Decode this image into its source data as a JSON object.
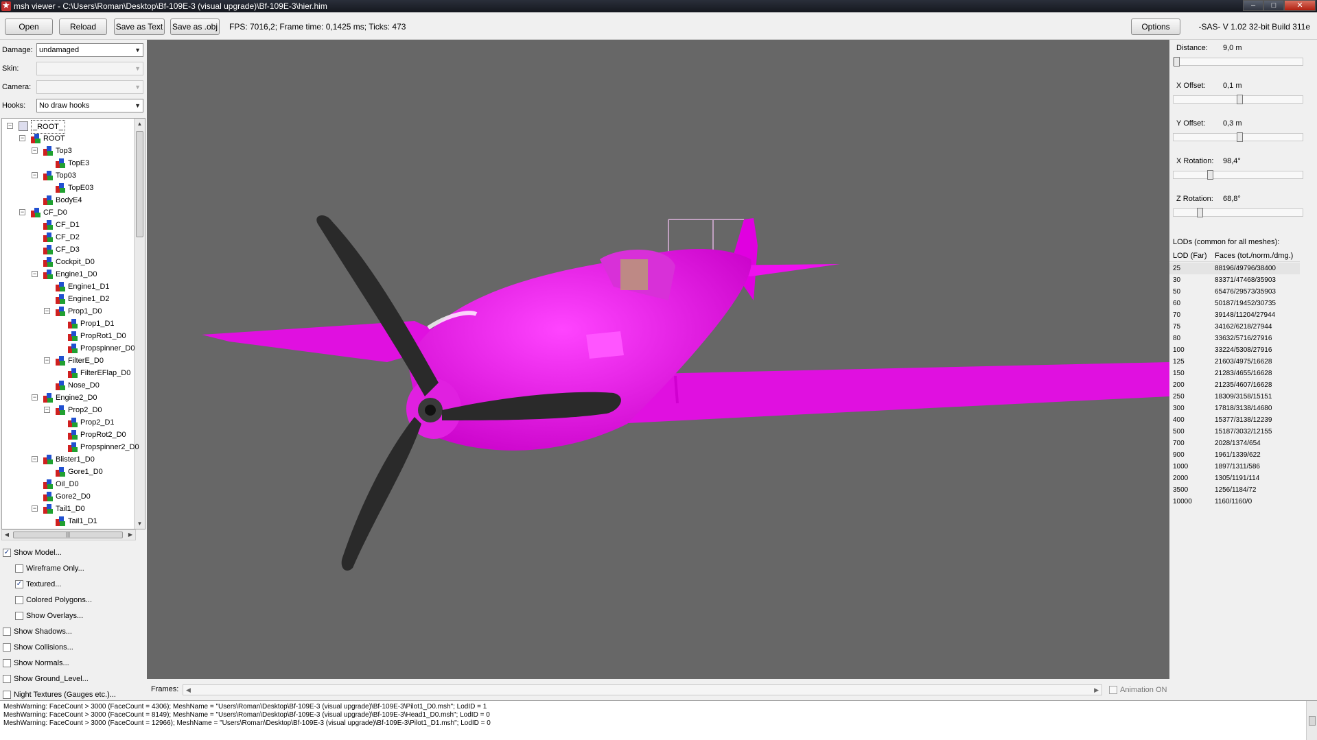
{
  "window": {
    "title": "msh viewer - C:\\Users\\Roman\\Desktop\\Bf-109E-3 (visual upgrade)\\Bf-109E-3\\hier.him"
  },
  "toolbar": {
    "open": "Open",
    "reload": "Reload",
    "save_text": "Save as Text",
    "save_obj": "Save as .obj",
    "fps": "FPS: 7016,2; Frame time: 0,1425 ms; Ticks: 473",
    "options": "Options",
    "version": "-SAS- V 1.02  32-bit  Build 311e"
  },
  "left": {
    "damage_label": "Damage:",
    "damage_value": "undamaged",
    "skin_label": "Skin:",
    "skin_value": "",
    "camera_label": "Camera:",
    "camera_value": "",
    "hooks_label": "Hooks:",
    "hooks_value": "No draw hooks"
  },
  "tree": {
    "root_label": "_ROOT_",
    "nodes": [
      {
        "label": "ROOT",
        "depth": 1,
        "expand": "−"
      },
      {
        "label": "Top3",
        "depth": 2,
        "expand": "−"
      },
      {
        "label": "TopE3",
        "depth": 3,
        "expand": ""
      },
      {
        "label": "Top03",
        "depth": 2,
        "expand": "−"
      },
      {
        "label": "TopE03",
        "depth": 3,
        "expand": ""
      },
      {
        "label": "BodyE4",
        "depth": 2,
        "expand": ""
      },
      {
        "label": "CF_D0",
        "depth": 1,
        "expand": "−"
      },
      {
        "label": "CF_D1",
        "depth": 2,
        "expand": ""
      },
      {
        "label": "CF_D2",
        "depth": 2,
        "expand": ""
      },
      {
        "label": "CF_D3",
        "depth": 2,
        "expand": ""
      },
      {
        "label": "Cockpit_D0",
        "depth": 2,
        "expand": ""
      },
      {
        "label": "Engine1_D0",
        "depth": 2,
        "expand": "−"
      },
      {
        "label": "Engine1_D1",
        "depth": 3,
        "expand": ""
      },
      {
        "label": "Engine1_D2",
        "depth": 3,
        "expand": ""
      },
      {
        "label": "Prop1_D0",
        "depth": 3,
        "expand": "−"
      },
      {
        "label": "Prop1_D1",
        "depth": 4,
        "expand": ""
      },
      {
        "label": "PropRot1_D0",
        "depth": 4,
        "expand": ""
      },
      {
        "label": "Propspinner_D0",
        "depth": 4,
        "expand": ""
      },
      {
        "label": "FilterE_D0",
        "depth": 3,
        "expand": "−"
      },
      {
        "label": "FilterEFlap_D0",
        "depth": 4,
        "expand": ""
      },
      {
        "label": "Nose_D0",
        "depth": 3,
        "expand": ""
      },
      {
        "label": "Engine2_D0",
        "depth": 2,
        "expand": "−"
      },
      {
        "label": "Prop2_D0",
        "depth": 3,
        "expand": "−"
      },
      {
        "label": "Prop2_D1",
        "depth": 4,
        "expand": ""
      },
      {
        "label": "PropRot2_D0",
        "depth": 4,
        "expand": ""
      },
      {
        "label": "Propspinner2_D0",
        "depth": 4,
        "expand": ""
      },
      {
        "label": "Blister1_D0",
        "depth": 2,
        "expand": "−"
      },
      {
        "label": "Gore1_D0",
        "depth": 3,
        "expand": ""
      },
      {
        "label": "Oil_D0",
        "depth": 2,
        "expand": ""
      },
      {
        "label": "Gore2_D0",
        "depth": 2,
        "expand": ""
      },
      {
        "label": "Tail1_D0",
        "depth": 2,
        "expand": "−"
      },
      {
        "label": "Tail1_D1",
        "depth": 3,
        "expand": ""
      }
    ]
  },
  "checks": [
    {
      "label": "Show Model...",
      "checked": true,
      "indent": 0
    },
    {
      "label": "Wireframe Only...",
      "checked": false,
      "indent": 1
    },
    {
      "label": "Textured...",
      "checked": true,
      "indent": 1
    },
    {
      "label": "Colored Polygons...",
      "checked": false,
      "indent": 1
    },
    {
      "label": "Show Overlays...",
      "checked": false,
      "indent": 1
    },
    {
      "label": "Show Shadows...",
      "checked": false,
      "indent": 0
    },
    {
      "label": "Show Collisions...",
      "checked": false,
      "indent": 0
    },
    {
      "label": "Show Normals...",
      "checked": false,
      "indent": 0
    },
    {
      "label": "Show Ground_Level...",
      "checked": false,
      "indent": 0
    },
    {
      "label": "Night Textures (Gauges etc.)...",
      "checked": false,
      "indent": 0
    }
  ],
  "frames": {
    "label": "Frames:",
    "animation": "Animation ON"
  },
  "params": [
    {
      "label": "Distance:",
      "value": "9,0 m",
      "fraction": 0.0
    },
    {
      "label": "X Offset:",
      "value": "0,1 m",
      "fraction": 0.51
    },
    {
      "label": "Y Offset:",
      "value": "0,3 m",
      "fraction": 0.51
    },
    {
      "label": "X Rotation:",
      "value": "98,4°",
      "fraction": 0.27
    },
    {
      "label": "Z Rotation:",
      "value": "68,8°",
      "fraction": 0.19
    }
  ],
  "lods": {
    "title": "LODs (common for all meshes):",
    "col1": "LOD (Far)",
    "col2": "Faces (tot./norm./dmg.)",
    "rows": [
      [
        "25",
        "88196/49796/38400"
      ],
      [
        "30",
        "83371/47468/35903"
      ],
      [
        "50",
        "65476/29573/35903"
      ],
      [
        "60",
        "50187/19452/30735"
      ],
      [
        "70",
        "39148/11204/27944"
      ],
      [
        "75",
        "34162/6218/27944"
      ],
      [
        "80",
        "33632/5716/27916"
      ],
      [
        "100",
        "33224/5308/27916"
      ],
      [
        "125",
        "21603/4975/16628"
      ],
      [
        "150",
        "21283/4655/16628"
      ],
      [
        "200",
        "21235/4607/16628"
      ],
      [
        "250",
        "18309/3158/15151"
      ],
      [
        "300",
        "17818/3138/14680"
      ],
      [
        "400",
        "15377/3138/12239"
      ],
      [
        "500",
        "15187/3032/12155"
      ],
      [
        "700",
        "2028/1374/654"
      ],
      [
        "900",
        "1961/1339/622"
      ],
      [
        "1000",
        "1897/1311/586"
      ],
      [
        "2000",
        "1305/1191/114"
      ],
      [
        "3500",
        "1256/1184/72"
      ],
      [
        "10000",
        "1160/1160/0"
      ]
    ]
  },
  "log": [
    "MeshWarning: FaceCount > 3000 (FaceCount = 4306); MeshName = \"Users\\Roman\\Desktop\\Bf-109E-3 (visual upgrade)\\Bf-109E-3\\Pilot1_D0.msh\"; LodID = 1",
    "MeshWarning: FaceCount > 3000 (FaceCount = 8149); MeshName = \"Users\\Roman\\Desktop\\Bf-109E-3 (visual upgrade)\\Bf-109E-3\\Head1_D0.msh\"; LodID = 0",
    "MeshWarning: FaceCount > 3000 (FaceCount = 12966); MeshName = \"Users\\Roman\\Desktop\\Bf-109E-3 (visual upgrade)\\Bf-109E-3\\Pilot1_D1.msh\"; LodID = 0"
  ]
}
